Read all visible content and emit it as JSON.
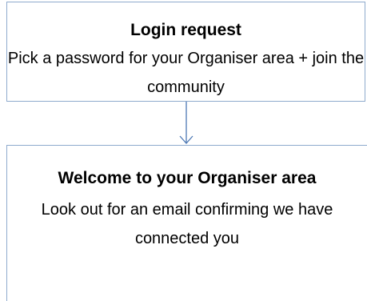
{
  "steps": [
    {
      "title": "Login request",
      "text": "Pick a password for your Organiser area + join the community"
    },
    {
      "title": "Welcome to your Organiser area",
      "text": "Look out for an email confirming we have connected you"
    }
  ],
  "colors": {
    "border": "#8eaacd",
    "arrow": "#4f7ab5",
    "text": "#000000",
    "background": "#ffffff"
  }
}
